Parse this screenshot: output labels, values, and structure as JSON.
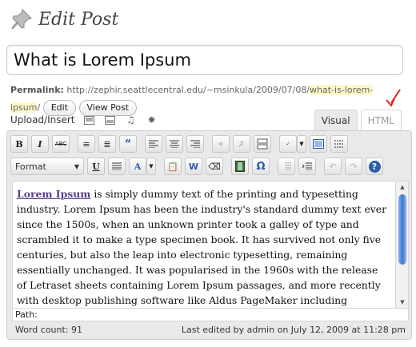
{
  "page": {
    "title": "Edit Post"
  },
  "post": {
    "title": "What is Lorem Ipsum"
  },
  "permalink": {
    "label": "Permalink:",
    "url_base": "http://zephir.seattlecentral.edu/~msinkula/2009/07/08/",
    "slug": "what-is-lorem-ipsum",
    "trailing": "/",
    "edit_button": "Edit",
    "view_button": "View Post"
  },
  "media": {
    "upload_insert_label": "Upload/Insert"
  },
  "editor_tabs": {
    "visual": "Visual",
    "html": "HTML"
  },
  "toolbar": {
    "bold": "B",
    "italic": "I",
    "strikethrough": "ABC",
    "underline": "U",
    "format_select": "Format",
    "help": "?"
  },
  "content": {
    "link_text": "Lorem Ipsum",
    "body": " is simply dummy text of the printing and typesetting industry. Lorem Ipsum has been the industry's standard dummy text ever since the 1500s, when an unknown printer took a galley of type and scrambled it to make a type specimen book. It has survived not only five centuries, but also the leap into electronic typesetting, remaining essentially unchanged. It was popularised in the 1960s with the release of Letraset sheets containing Lorem Ipsum passages, and more recently with desktop publishing software like Aldus PageMaker including versions of Lorem Ipsum."
  },
  "path_label": "Path:",
  "status": {
    "word_count": "Word count: 91",
    "last_edited": "Last edited by admin on July 12, 2009 at 11:28 pm"
  },
  "colors": {
    "link": "#5a3e8a",
    "slug_highlight": "#fff8c8",
    "arrow": "#e0261f"
  }
}
